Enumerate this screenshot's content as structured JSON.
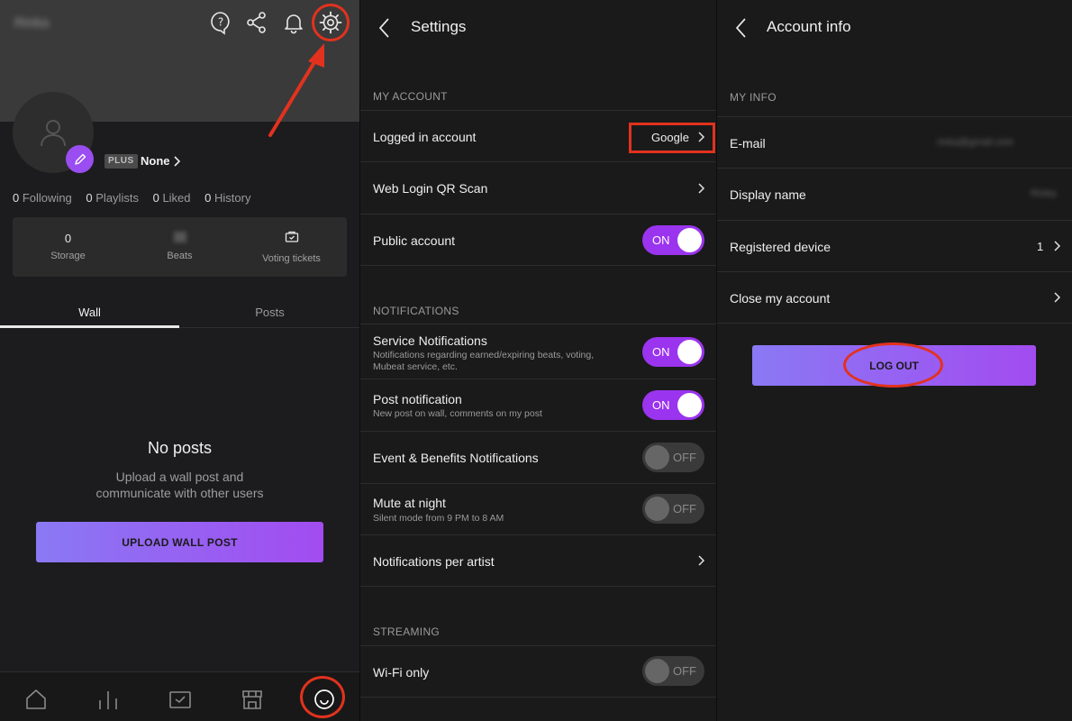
{
  "profile": {
    "username": "Rinka",
    "plan_badge": "PLUS",
    "plan_name": "None",
    "stats": [
      {
        "num": "0",
        "label": "Following"
      },
      {
        "num": "0",
        "label": "Playlists"
      },
      {
        "num": "0",
        "label": "Liked"
      },
      {
        "num": "0",
        "label": "History"
      }
    ],
    "storage": {
      "value": "0",
      "label": "Storage"
    },
    "beats": {
      "label": "Beats"
    },
    "voting": {
      "label": "Voting tickets"
    },
    "tabs": [
      {
        "label": "Wall"
      },
      {
        "label": "Posts"
      }
    ],
    "empty_title": "No posts",
    "empty_line1": "Upload a wall post and",
    "empty_line2": "communicate with other users",
    "upload_button": "UPLOAD WALL POST"
  },
  "settings": {
    "title": "Settings",
    "sections": {
      "account": "MY ACCOUNT",
      "notifications": "NOTIFICATIONS",
      "streaming": "STREAMING"
    },
    "logged_in": {
      "label": "Logged in account",
      "value": "Google"
    },
    "web_login": {
      "label": "Web Login QR Scan"
    },
    "public_account": {
      "label": "Public account",
      "state": "ON"
    },
    "service_notifications": {
      "label": "Service Notifications",
      "sub1": "Notifications regarding earned/expiring beats, voting,",
      "sub2": "Mubeat service, etc.",
      "state": "ON"
    },
    "post_notification": {
      "label": "Post notification",
      "sub": "New post on wall, comments on my post",
      "state": "ON"
    },
    "event_notifications": {
      "label": "Event & Benefits Notifications",
      "state": "OFF"
    },
    "mute_night": {
      "label": "Mute at night",
      "sub": "Silent mode from 9 PM to 8 AM",
      "state": "OFF"
    },
    "per_artist": {
      "label": "Notifications per artist"
    },
    "wifi_only": {
      "label": "Wi-Fi only",
      "state": "OFF"
    }
  },
  "account_info": {
    "title": "Account info",
    "section": "MY INFO",
    "email": {
      "label": "E-mail",
      "value": "rinka@gmail.com"
    },
    "display_name": {
      "label": "Display name",
      "value": "Rinka"
    },
    "registered_device": {
      "label": "Registered device",
      "value": "1"
    },
    "close_account": {
      "label": "Close my account"
    },
    "logout_button": "LOG OUT"
  },
  "colors": {
    "accent": "#9a34ee",
    "gradient_start": "#8a79f4",
    "gradient_end": "#a24cf0",
    "annotation_red": "#e2321e"
  }
}
